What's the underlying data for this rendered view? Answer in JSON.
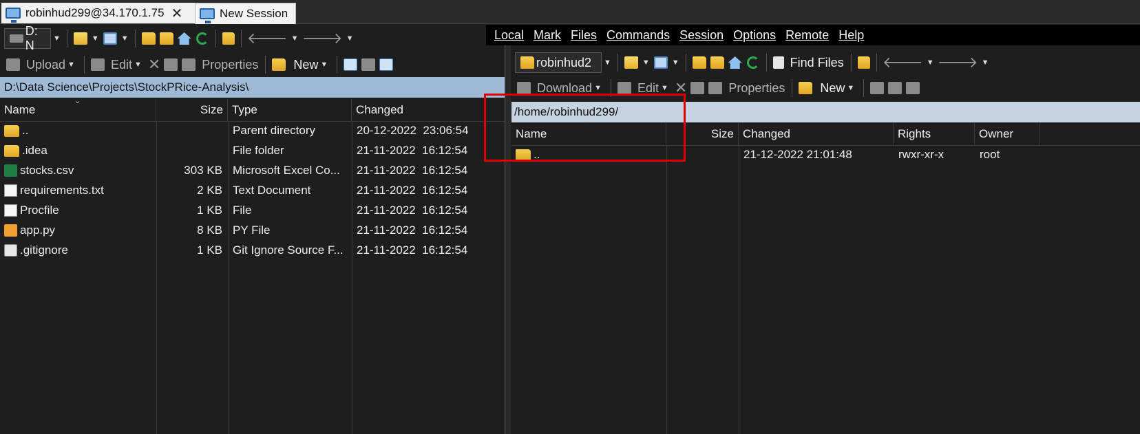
{
  "tabs": [
    {
      "label": "robinhud299@34.170.1.75",
      "active": true
    },
    {
      "label": "New Session",
      "active": false
    }
  ],
  "local": {
    "drive": "D: N",
    "toolbar2": {
      "upload": "Upload",
      "edit": "Edit",
      "properties": "Properties",
      "new": "New"
    },
    "path": "D:\\Data Science\\Projects\\StockPRice-Analysis\\",
    "columns": [
      "Name",
      "Size",
      "Type",
      "Changed"
    ],
    "files": [
      {
        "name": "..",
        "size": "",
        "type": "Parent directory",
        "changed": "20-12-2022  23:06:54",
        "icon": "parent-folder-icon"
      },
      {
        "name": ".idea",
        "size": "",
        "type": "File folder",
        "changed": "21-11-2022  16:12:54",
        "icon": "folder-icon"
      },
      {
        "name": "stocks.csv",
        "size": "303 KB",
        "type": "Microsoft Excel Co...",
        "changed": "21-11-2022  16:12:54",
        "icon": "excel-icon"
      },
      {
        "name": "requirements.txt",
        "size": "2 KB",
        "type": "Text Document",
        "changed": "21-11-2022  16:12:54",
        "icon": "text-file-icon"
      },
      {
        "name": "Procfile",
        "size": "1 KB",
        "type": "File",
        "changed": "21-11-2022  16:12:54",
        "icon": "file-icon"
      },
      {
        "name": "app.py",
        "size": "8 KB",
        "type": "PY File",
        "changed": "21-11-2022  16:12:54",
        "icon": "python-file-icon"
      },
      {
        "name": ".gitignore",
        "size": "1 KB",
        "type": "Git Ignore Source F...",
        "changed": "21-11-2022  16:12:54",
        "icon": "gitignore-file-icon"
      }
    ]
  },
  "remote": {
    "menu": [
      "Local",
      "Mark",
      "Files",
      "Commands",
      "Session",
      "Options",
      "Remote",
      "Help"
    ],
    "dir_combo": "robinhud2",
    "find_files": "Find Files",
    "toolbar2": {
      "download": "Download",
      "edit": "Edit",
      "properties": "Properties",
      "new": "New"
    },
    "path": "/home/robinhud299/",
    "columns": [
      "Name",
      "Size",
      "Changed",
      "Rights",
      "Owner"
    ],
    "files": [
      {
        "name": "..",
        "size": "",
        "changed": "21-12-2022 21:01:48",
        "rights": "rwxr-xr-x",
        "owner": "root",
        "icon": "parent-folder-icon"
      }
    ]
  },
  "colors": {
    "pathbar_local": "#9fbad6",
    "pathbar_remote": "#c5d3e0",
    "highlight": "#e00000"
  }
}
